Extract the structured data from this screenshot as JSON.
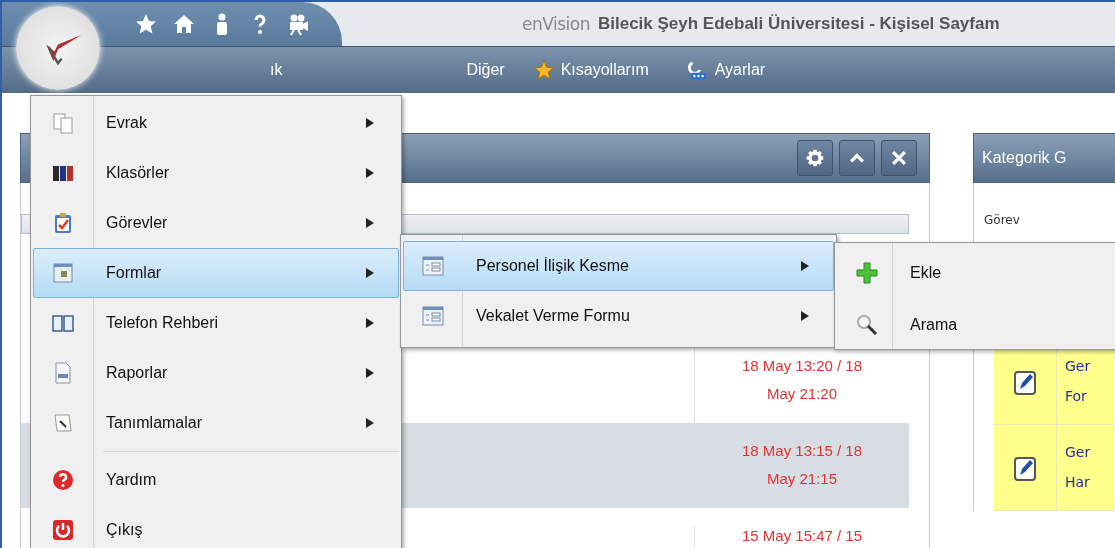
{
  "header": {
    "logo": "enVision",
    "title": "Bilecik Şeyh Edebali Üniversitesi - Kişisel Sayfam"
  },
  "nav": [
    {
      "label": "ık",
      "kind": "text"
    },
    {
      "label": "Diğer",
      "kind": "text"
    },
    {
      "label": "Kısayollarım",
      "kind": "star"
    },
    {
      "label": "Ayarlar",
      "kind": "tools"
    }
  ],
  "left_panel": {
    "rows": [
      {
        "date": "18 May 13:20 / 18 May 21:20",
        "selected": false
      },
      {
        "date": "18 May 13:15 / 18 May 21:15",
        "selected": true
      },
      {
        "date": "15 May 15:47 / 15",
        "selected": false
      }
    ]
  },
  "right_panel": {
    "title": "Kategorik G",
    "column": "Görev",
    "rows": [
      {
        "line1": "Ger",
        "line2": "For"
      },
      {
        "line1": "Ger",
        "line2": "Har"
      }
    ]
  },
  "main_menu": [
    {
      "label": "Evrak",
      "submenu": true,
      "selected": false
    },
    {
      "label": "Klasörler",
      "submenu": true,
      "selected": false
    },
    {
      "label": "Görevler",
      "submenu": true,
      "selected": false
    },
    {
      "label": "Formlar",
      "submenu": true,
      "selected": true
    },
    {
      "label": "Telefon Rehberi",
      "submenu": true,
      "selected": false
    },
    {
      "label": "Raporlar",
      "submenu": true,
      "selected": false
    },
    {
      "label": "Tanımlamalar",
      "submenu": true,
      "selected": false
    },
    {
      "label": "Yardım",
      "submenu": false,
      "selected": false
    },
    {
      "label": "Çıkış",
      "submenu": false,
      "selected": false
    }
  ],
  "forms_menu": [
    {
      "label": "Personel İlişik Kesme",
      "submenu": true,
      "selected": true
    },
    {
      "label": "Vekalet Verme Formu",
      "submenu": true,
      "selected": false
    }
  ],
  "action_menu": [
    {
      "label": "Ekle",
      "selected": false
    },
    {
      "label": "Arama",
      "selected": false
    }
  ]
}
